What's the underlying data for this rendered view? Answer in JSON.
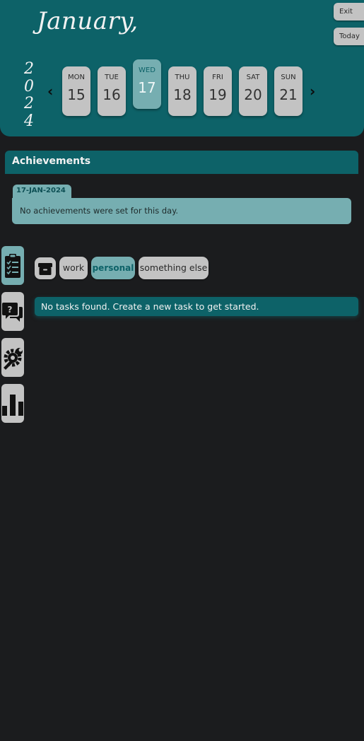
{
  "header": {
    "month": "January,",
    "year_digits": [
      "2",
      "0",
      "2",
      "4"
    ],
    "exit_label": "Exit",
    "today_label": "Today",
    "prev_arrow": "‹",
    "next_arrow": "›"
  },
  "week": [
    {
      "dow": "MON",
      "num": "15"
    },
    {
      "dow": "TUE",
      "num": "16"
    },
    {
      "dow": "WED",
      "num": "17"
    },
    {
      "dow": "THU",
      "num": "18"
    },
    {
      "dow": "FRI",
      "num": "19"
    },
    {
      "dow": "SAT",
      "num": "20"
    },
    {
      "dow": "SUN",
      "num": "21"
    }
  ],
  "selected_day": "WED 17",
  "achievements": {
    "title": "Achievements",
    "date_tab": "17-JAN-2024",
    "empty_text": "No achievements were set for this day."
  },
  "sidebar": {
    "items": [
      {
        "icon": "clipboard-checklist-icon",
        "active": true
      },
      {
        "icon": "chat-question-icon",
        "active": false
      },
      {
        "icon": "gear-wrench-icon",
        "active": false
      },
      {
        "icon": "bar-chart-icon",
        "active": false
      }
    ]
  },
  "categories": {
    "archive_icon": "archive-box-icon",
    "chips": [
      "work",
      "personal",
      "something else"
    ],
    "selected": "personal"
  },
  "tasks": {
    "empty_text": "No tasks found. Create a new task to get started."
  },
  "colors": {
    "background": "#1b1c1e",
    "teal": "#0d6268",
    "light_teal": "#76aeb1",
    "grey": "#c3c3c3"
  }
}
